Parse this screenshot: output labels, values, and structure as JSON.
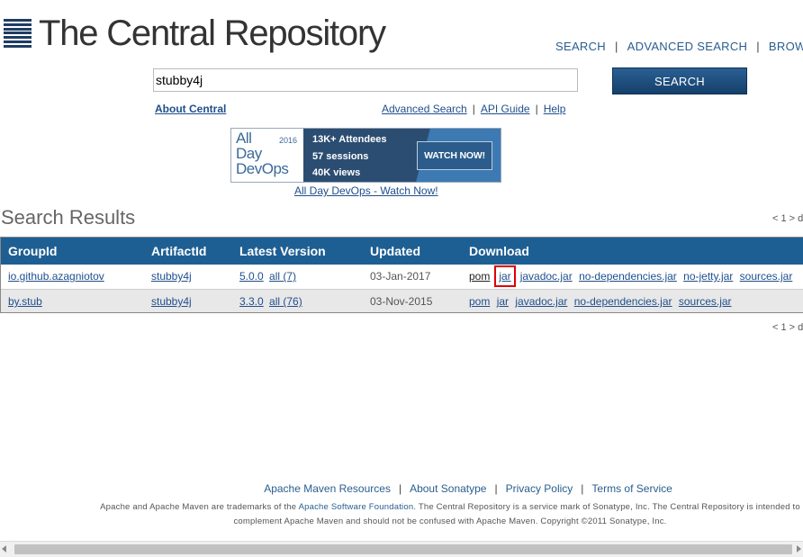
{
  "header": {
    "logo_text": "The Central Repository",
    "nav": [
      {
        "label": "SEARCH"
      },
      {
        "label": "ADVANCED SEARCH"
      },
      {
        "label": "BROWSE"
      }
    ]
  },
  "search": {
    "value": "stubby4j",
    "button_label": "SEARCH"
  },
  "sublinks": {
    "about": "About Central",
    "advanced": "Advanced Search",
    "api": "API Guide",
    "help": "Help"
  },
  "banner": {
    "brand": "All\nDay\nDevOps",
    "year": "2016",
    "stats": [
      "13K+ Attendees",
      "57 sessions",
      "40K views"
    ],
    "cta": "WATCH NOW!",
    "link": "All Day DevOps - Watch Now!"
  },
  "results": {
    "title": "Search Results",
    "pager": "< 1 > d",
    "columns": [
      "GroupId",
      "ArtifactId",
      "Latest Version",
      "Updated",
      "Download"
    ],
    "rows": [
      {
        "group": "io.github.azagniotov",
        "artifact": "stubby4j",
        "version": "5.0.0",
        "all": "all (7)",
        "updated": "03-Jan-2017",
        "downloads": [
          "pom",
          "jar",
          "javadoc.jar",
          "no-dependencies.jar",
          "no-jetty.jar",
          "sources.jar"
        ]
      },
      {
        "group": "by.stub",
        "artifact": "stubby4j",
        "version": "3.3.0",
        "all": "all (76)",
        "updated": "03-Nov-2015",
        "downloads": [
          "pom",
          "jar",
          "javadoc.jar",
          "no-dependencies.jar",
          "sources.jar"
        ]
      }
    ]
  },
  "footer": {
    "links": [
      "Apache Maven Resources",
      "About Sonatype",
      "Privacy Policy",
      "Terms of Service"
    ],
    "legal_1": "Apache and Apache Maven are trademarks of the",
    "legal_link": "Apache Software Foundation",
    "legal_2": ". The Central Repository is a service mark of Sonatype, Inc. The Central Repository is intended to complement Apache Maven and should not be confused with Apache Maven. Copyright ©2011 Sonatype, Inc."
  },
  "colors": {
    "table_header": "#1e5f93",
    "link": "#1f4e8c",
    "highlight": "#e00000"
  }
}
